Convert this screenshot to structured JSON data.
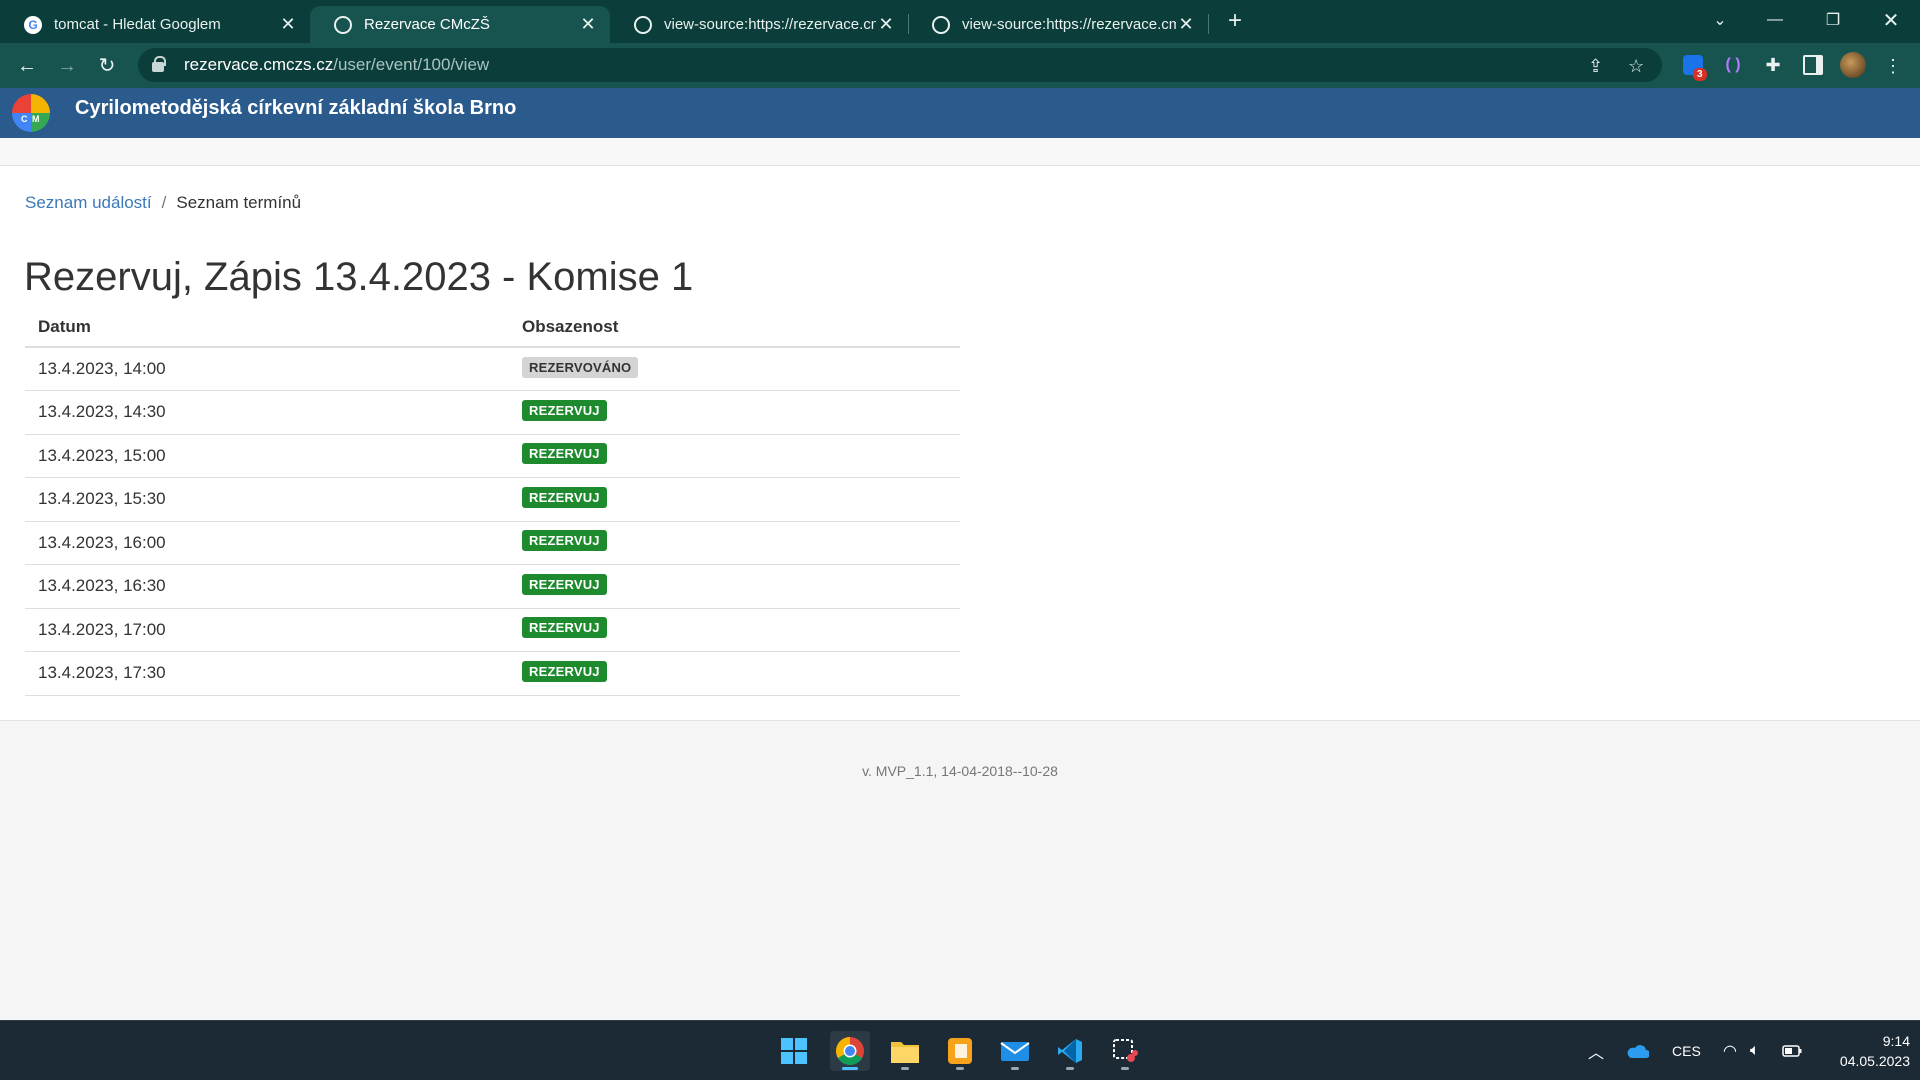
{
  "browser": {
    "tabs": [
      {
        "title": "tomcat - Hledat Googlem",
        "icon": "google-icon",
        "active": false
      },
      {
        "title": "Rezervace CMcZŠ",
        "icon": "globe-icon",
        "active": true
      },
      {
        "title": "view-source:https://rezervace.cm",
        "icon": "globe-icon",
        "active": false
      },
      {
        "title": "view-source:https://rezervace.cm",
        "icon": "globe-icon",
        "active": false
      }
    ],
    "url_host": "rezervace.cmczs.cz",
    "url_path": "/user/event/100/view",
    "extension_badge": "3"
  },
  "site": {
    "logo_letters": [
      "C",
      "M"
    ],
    "title": "Cyrilometodějská církevní základní škola Brno"
  },
  "breadcrumb": {
    "link": "Seznam událostí",
    "separator": "/",
    "current": "Seznam termínů"
  },
  "page_title": "Rezervuj, Zápis 13.4.2023 - Komise 1",
  "table": {
    "headers": [
      "Datum",
      "Obsazenost"
    ],
    "rows": [
      {
        "datum": "13.4.2023, 14:00",
        "status": "REZERVOVÁNO",
        "type": "reserved"
      },
      {
        "datum": "13.4.2023, 14:30",
        "status": "REZERVUJ",
        "type": "available"
      },
      {
        "datum": "13.4.2023, 15:00",
        "status": "REZERVUJ",
        "type": "available"
      },
      {
        "datum": "13.4.2023, 15:30",
        "status": "REZERVUJ",
        "type": "available"
      },
      {
        "datum": "13.4.2023, 16:00",
        "status": "REZERVUJ",
        "type": "available"
      },
      {
        "datum": "13.4.2023, 16:30",
        "status": "REZERVUJ",
        "type": "available"
      },
      {
        "datum": "13.4.2023, 17:00",
        "status": "REZERVUJ",
        "type": "available"
      },
      {
        "datum": "13.4.2023, 17:30",
        "status": "REZERVUJ",
        "type": "available"
      }
    ]
  },
  "footer": {
    "version": "v. MVP_1.1, 14-04-2018--10-28"
  },
  "taskbar": {
    "apps": [
      "start-icon",
      "chrome-icon",
      "file-explorer-icon",
      "office-icon",
      "mail-icon",
      "vscode-icon",
      "snipping-tool-icon"
    ],
    "language": "CES",
    "time": "9:14",
    "date": "04.05.2023"
  },
  "colors": {
    "available": "#1e8a2e",
    "reserved": "#d4d4d4",
    "header": "#2b5a8c",
    "link": "#3a79b8"
  }
}
